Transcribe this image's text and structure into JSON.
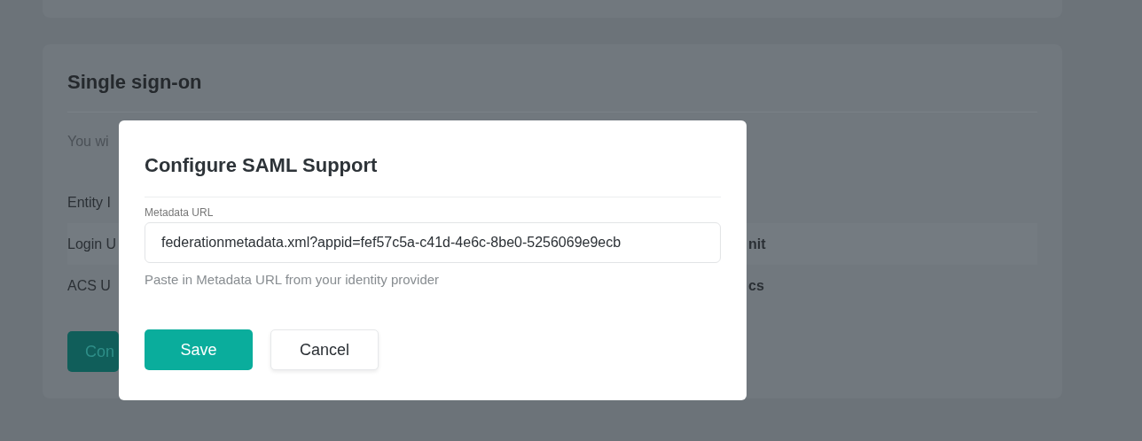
{
  "background_card": {
    "title": "Single sign-on",
    "description": "You wi",
    "fields": [
      {
        "label": "Entity I"
      },
      {
        "label": "Login U",
        "value": "nit"
      },
      {
        "label": "ACS U",
        "value": "cs"
      }
    ],
    "button": "Con"
  },
  "dialog": {
    "title": "Configure SAML Support",
    "field_label": "Metadata URL",
    "field_value": "federationmetadata.xml?appid=fef57c5a-c41d-4e6c-8be0-5256069e9ecb",
    "hint": "Paste in Metadata URL from your identity provider",
    "buttons": [
      {
        "label": "Save",
        "kind": "primary"
      },
      {
        "label": "Cancel",
        "kind": "secondary"
      }
    ]
  }
}
